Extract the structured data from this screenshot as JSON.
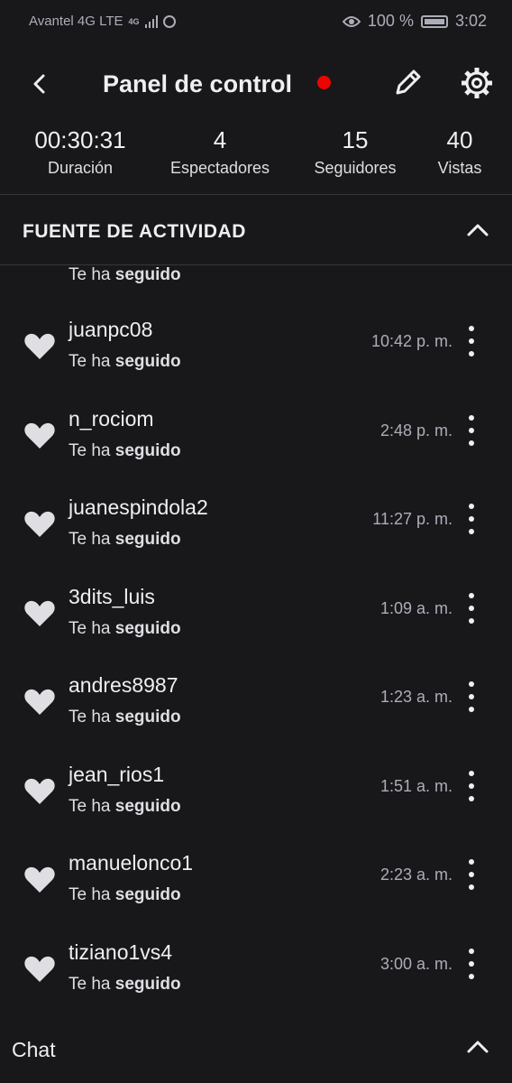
{
  "status_bar": {
    "carrier": "Avantel 4G LTE",
    "net_badge": "4G",
    "battery_percent": "100 %",
    "time": "3:02"
  },
  "header": {
    "title": "Panel de control",
    "live_indicator_color": "#eb0400"
  },
  "stats": [
    {
      "value": "00:30:31",
      "label": "Duración"
    },
    {
      "value": "4",
      "label": "Espectadores"
    },
    {
      "value": "15",
      "label": "Seguidores"
    },
    {
      "value": "40",
      "label": "Vistas"
    }
  ],
  "activity": {
    "title": "FUENTE DE ACTIVIDAD",
    "action_prefix": "Te ha",
    "action_bold": "seguido",
    "partial_top": {
      "prefix": "Te ha",
      "bold": "seguido"
    },
    "items": [
      {
        "username": "juanpc08",
        "time": "10:42 p. m."
      },
      {
        "username": "n_rociom",
        "time": "2:48 p. m."
      },
      {
        "username": "juanespindola2",
        "time": "11:27 p. m."
      },
      {
        "username": "3dits_luis",
        "time": "1:09 a. m."
      },
      {
        "username": "andres8987",
        "time": "1:23 a. m."
      },
      {
        "username": "jean_rios1",
        "time": "1:51 a. m."
      },
      {
        "username": "manuelonco1",
        "time": "2:23 a. m."
      },
      {
        "username": "tiziano1vs4",
        "time": "3:00 a. m."
      }
    ]
  },
  "chat": {
    "label": "Chat"
  },
  "icons": {
    "back": "chevron-left-icon",
    "edit": "pencil-icon",
    "settings": "gear-icon",
    "follow": "heart-icon",
    "more": "more-vertical-icon",
    "collapse": "chevron-up-icon"
  },
  "colors": {
    "background": "#18181b",
    "text": "#efeff1",
    "muted": "#adadb8",
    "heart": "#dedee3"
  }
}
